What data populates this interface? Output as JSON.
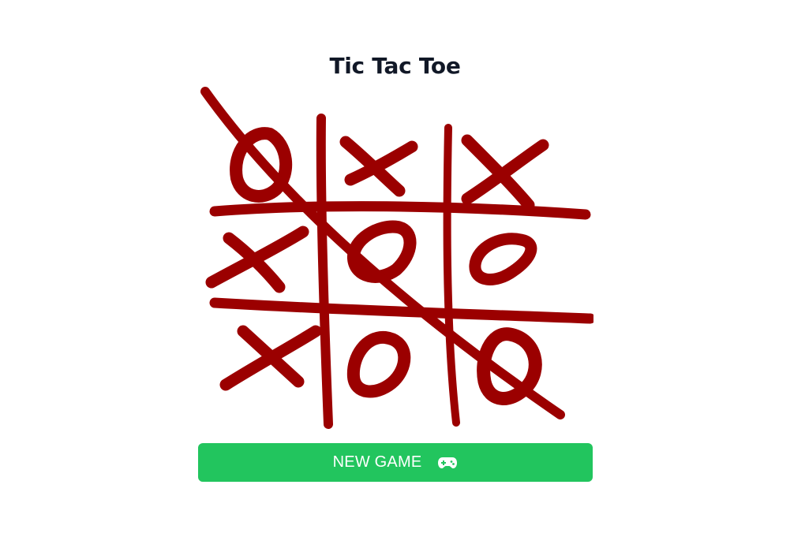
{
  "app": {
    "title": "Tic Tac Toe"
  },
  "board": {
    "cells": [
      "O",
      "X",
      "X",
      "X",
      "O",
      "O",
      "X",
      "O",
      "O"
    ],
    "winning_line": "diagonal-top-left-to-bottom-right",
    "ink_color": "#9b0000"
  },
  "controls": {
    "new_game_label": "NEW GAME",
    "new_game_icon": "gamepad-icon",
    "button_color": "#22c55e"
  }
}
